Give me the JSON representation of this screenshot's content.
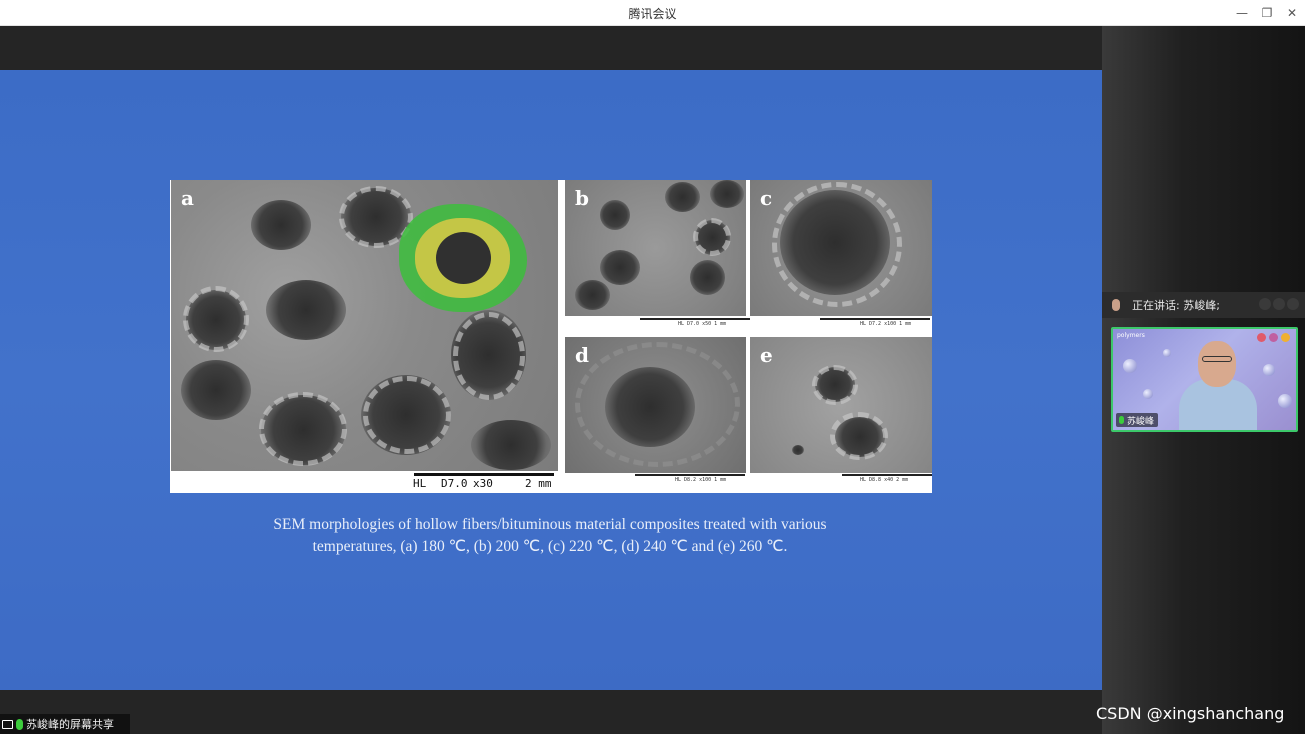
{
  "window": {
    "title": "腾讯会议",
    "minimize_glyph": "—",
    "restore_glyph": "❐",
    "close_glyph": "✕"
  },
  "slide": {
    "panels": {
      "a": "a",
      "b": "b",
      "c": "c",
      "d": "d",
      "e": "e"
    },
    "scalebar": {
      "detector": "HL",
      "distance": "D7.0",
      "magnification": "x30",
      "length": "2 mm"
    },
    "mini_scalebars": {
      "b": "HL D7.0 x50 1 mm",
      "c": "HL D7.2 x100 1 mm",
      "d": "HL D8.2 x100 1 mm",
      "e": "HL D8.8 x40 2 mm"
    },
    "caption_line1": "SEM morphologies of hollow fibers/bituminous material composites treated with various",
    "caption_line2": "temperatures, (a) 180 ℃, (b) 200 ℃, (c) 220 ℃, (d) 240 ℃ and (e) 260 ℃."
  },
  "share_indicator": {
    "label": "苏峻峰的屏幕共享"
  },
  "side_panel": {
    "speaking_text": "正在讲话: 苏峻峰;",
    "video_tile": {
      "participant_name": "苏峻峰",
      "background_logos": "polymers"
    }
  },
  "watermark": "CSDN @xingshanchang",
  "colors": {
    "slide_blue": "#3f6ec8",
    "active_speaker_border": "#3cc86a",
    "mic_active": "#3ccc3c"
  }
}
